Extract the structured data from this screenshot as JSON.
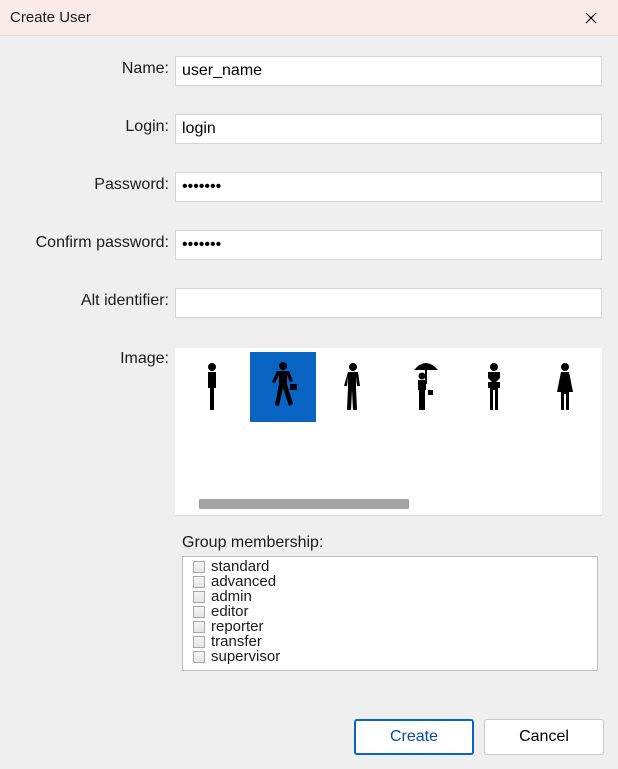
{
  "title": "Create User",
  "fields": {
    "name": {
      "label": "Name:",
      "value": "user_name"
    },
    "login": {
      "label": "Login:",
      "value": "login"
    },
    "password": {
      "label": "Password:",
      "value": "•••••••"
    },
    "confirm": {
      "label": "Confirm password:",
      "value": "•••••••"
    },
    "altid": {
      "label": "Alt identifier:",
      "value": ""
    },
    "image": {
      "label": "Image:"
    }
  },
  "image_options": [
    {
      "name": "person-standing-icon",
      "selected": false
    },
    {
      "name": "person-briefcase-walking-icon",
      "selected": true
    },
    {
      "name": "person-standing-alt-icon",
      "selected": false
    },
    {
      "name": "person-umbrella-icon",
      "selected": false
    },
    {
      "name": "person-arms-crossed-icon",
      "selected": false
    },
    {
      "name": "person-female-icon",
      "selected": false
    }
  ],
  "groups": {
    "label": "Group membership:",
    "items": [
      {
        "label": "standard",
        "checked": false
      },
      {
        "label": "advanced",
        "checked": false
      },
      {
        "label": "admin",
        "checked": false
      },
      {
        "label": "editor",
        "checked": false
      },
      {
        "label": "reporter",
        "checked": false
      },
      {
        "label": "transfer",
        "checked": false
      },
      {
        "label": "supervisor",
        "checked": false
      }
    ]
  },
  "buttons": {
    "create": "Create",
    "cancel": "Cancel"
  }
}
